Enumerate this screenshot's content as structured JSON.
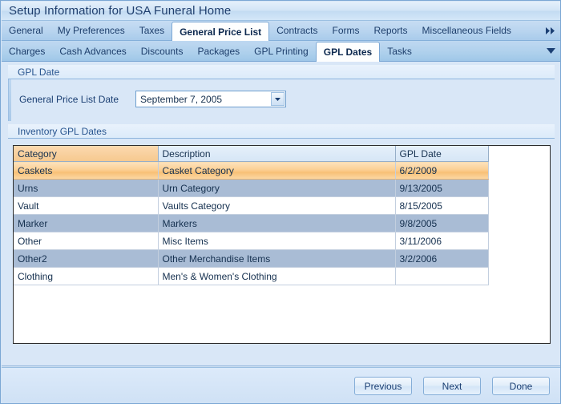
{
  "window": {
    "title": "Setup Information for USA Funeral Home"
  },
  "tabs_row1": {
    "items": [
      {
        "label": "General",
        "active": false
      },
      {
        "label": "My Preferences",
        "active": false
      },
      {
        "label": "Taxes",
        "active": false
      },
      {
        "label": "General Price List",
        "active": true
      },
      {
        "label": "Contracts",
        "active": false
      },
      {
        "label": "Forms",
        "active": false
      },
      {
        "label": "Reports",
        "active": false
      },
      {
        "label": "Miscellaneous Fields",
        "active": false
      }
    ],
    "overflow_icon": "double-chevron-right-icon"
  },
  "tabs_row2": {
    "items": [
      {
        "label": "Charges",
        "active": false
      },
      {
        "label": "Cash Advances",
        "active": false
      },
      {
        "label": "Discounts",
        "active": false
      },
      {
        "label": "Packages",
        "active": false
      },
      {
        "label": "GPL Printing",
        "active": false
      },
      {
        "label": "GPL Dates",
        "active": true
      },
      {
        "label": "Tasks",
        "active": false
      }
    ],
    "overflow_icon": "chevron-down-icon"
  },
  "gpl_date_group": {
    "header": "GPL Date",
    "field_label": "General Price List Date",
    "date_value": "September  7, 2005",
    "dropdown_icon": "chevron-down-icon"
  },
  "inventory_group": {
    "header": "Inventory GPL Dates"
  },
  "grid": {
    "columns": [
      "Category",
      "Description",
      "GPL Date"
    ],
    "rows": [
      {
        "category": "Caskets",
        "description": "Casket Category",
        "date": "6/2/2009",
        "state": "selected"
      },
      {
        "category": "Urns",
        "description": "Urn Category",
        "date": "9/13/2005",
        "state": "alt"
      },
      {
        "category": "Vault",
        "description": "Vaults Category",
        "date": "8/15/2005",
        "state": "normal"
      },
      {
        "category": "Marker",
        "description": "Markers",
        "date": "9/8/2005",
        "state": "alt"
      },
      {
        "category": "Other",
        "description": "Misc Items",
        "date": "3/11/2006",
        "state": "normal"
      },
      {
        "category": "Other2",
        "description": "Other Merchandise Items",
        "date": "3/2/2006",
        "state": "alt"
      },
      {
        "category": "Clothing",
        "description": "Men's & Women's Clothing",
        "date": "",
        "state": "normal"
      }
    ]
  },
  "footer": {
    "buttons": [
      {
        "label": "Previous"
      },
      {
        "label": "Next"
      },
      {
        "label": "Done"
      }
    ]
  },
  "colors": {
    "titlebar_text": "#1f3f6e",
    "window_border": "#7ba7d4",
    "page_bg": "#d9e7f7",
    "selected_row": "#f8c076",
    "alt_row": "#a9bcd5",
    "header_cat": "#f6c98f"
  }
}
